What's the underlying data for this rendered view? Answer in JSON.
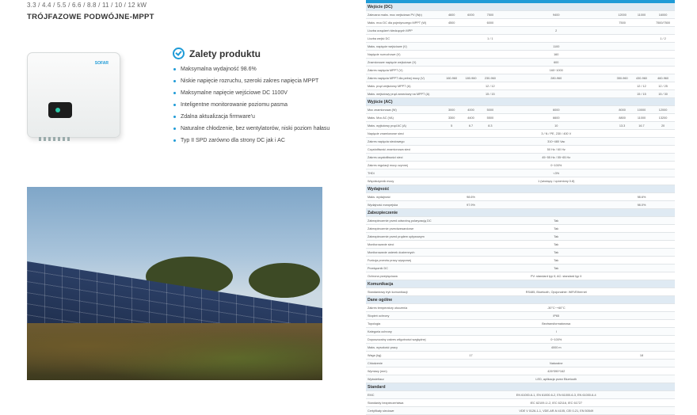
{
  "left": {
    "models": "3.3 / 4.4 / 5.5 / 6.6 / 8.8 / 11 / 10 / 12 kW",
    "heading": "TRÓJFAZOWE PODWÓJNE-MPPT",
    "brand": "SOFAR",
    "features_title": "Zalety produktu",
    "features": [
      "Maksymalna wydajność 98.6%",
      "Niskie napięcie rozruchu, szeroki zakres napięcia MPPT",
      "Maksymalne napięcie wejściowe DC 1100V",
      "Inteligentne monitorowanie poziomu pasma",
      "Zdalna aktualizacja firmware'u",
      "Naturalne chłodzenie, bez wentylatorów, niski poziom hałasu",
      "Typ II SPD zarówno dla strony DC jak i AC"
    ]
  },
  "spec": {
    "rows": [
      {
        "type": "sec",
        "label": "Wejście (DC)"
      },
      {
        "label": "Zalecana maks. moc wejściowa PV (Wp)",
        "values": [
          "4600",
          "6000",
          "7500",
          "9400",
          "12000",
          "11000",
          "16000"
        ]
      },
      {
        "label": "Maks. moc DC dla pojedynczego MPPT (W)",
        "values": [
          "4500",
          "",
          "6000",
          "",
          "7500",
          "",
          "7500/7500"
        ]
      },
      {
        "label": "Liczba urządzeń śledzących MPP",
        "values": [
          "",
          "",
          "",
          "2",
          "",
          "",
          ""
        ]
      },
      {
        "label": "Liczba wejść DC",
        "values": [
          "",
          "",
          "1 / 1",
          "",
          "",
          "",
          "1 / 2"
        ]
      },
      {
        "label": "Maks. napięcie wejściowe (V)",
        "values": [
          "",
          "",
          "",
          "1100",
          "",
          "",
          ""
        ]
      },
      {
        "label": "Napięcie rozruchowe (V)",
        "values": [
          "",
          "",
          "",
          "160",
          "",
          "",
          ""
        ]
      },
      {
        "label": "Znamionowe napięcie wejściowe (V)",
        "values": [
          "",
          "",
          "",
          "600",
          "",
          "",
          ""
        ]
      },
      {
        "label": "Zakres napięcia MPPT (V)",
        "values": [
          "",
          "",
          "",
          "160~1000",
          "",
          "",
          ""
        ]
      },
      {
        "label": "Zakres napięcia MPPT dla pełnej mocy (V)",
        "values": [
          "160-960",
          "180-960",
          "230-960",
          "280-960",
          "350-960",
          "430-960",
          "460-960"
        ]
      },
      {
        "label": "Maks. prąd wejściowy MPPT (A)",
        "values": [
          "",
          "",
          "12 / 12",
          "",
          "",
          "12 / 12",
          "12 / 25"
        ]
      },
      {
        "label": "Maks. wejściowy prąd zwarciowy na MPPT (A)",
        "values": [
          "",
          "",
          "15 / 15",
          "",
          "",
          "15 / 15",
          "15 / 30"
        ]
      },
      {
        "type": "sec",
        "label": "Wyjście (AC)"
      },
      {
        "label": "Moc znamionowa (W)",
        "values": [
          "3000",
          "4000",
          "5000",
          "6000",
          "8000",
          "10000",
          "12000"
        ]
      },
      {
        "label": "Maks. Moc AC (VA)",
        "values": [
          "3300",
          "4400",
          "5500",
          "6600",
          "8800",
          "11000",
          "13200"
        ]
      },
      {
        "label": "Maks. wyjściowy prąd AC (A)",
        "values": [
          "5",
          "6.7",
          "8.3",
          "10",
          "13.3",
          "16.7",
          "20"
        ]
      },
      {
        "label": "Napięcie znamionowe sieci",
        "values": [
          "",
          "",
          "",
          "3 / N / PE, 230 / 400 V",
          "",
          "",
          ""
        ]
      },
      {
        "label": "Zakres napięcia sieciowego",
        "values": [
          "",
          "",
          "",
          "310~480 Vac",
          "",
          "",
          ""
        ]
      },
      {
        "label": "Częstotliwość znamionowa sieci",
        "values": [
          "",
          "",
          "",
          "50 Hz / 60 Hz",
          "",
          "",
          ""
        ]
      },
      {
        "label": "Zakres częstotliwości sieci",
        "values": [
          "",
          "",
          "",
          "45~55 Hz / 55~65 Hz",
          "",
          "",
          ""
        ]
      },
      {
        "label": "Zakres regulacji mocy czynnej",
        "values": [
          "",
          "",
          "",
          "0~100%",
          "",
          "",
          ""
        ]
      },
      {
        "label": "THDi",
        "values": [
          "",
          "",
          "",
          "<3%",
          "",
          "",
          ""
        ]
      },
      {
        "label": "Współczynnik mocy",
        "values": [
          "",
          "",
          "",
          "1 (wiodący / opóźniony 0.8)",
          "",
          "",
          ""
        ]
      },
      {
        "type": "sec",
        "label": "Wydajność"
      },
      {
        "label": "Maks. wydajność",
        "values": [
          "",
          "98.6%",
          "",
          "",
          "",
          "98.6%",
          ""
        ]
      },
      {
        "label": "Wydajność europejska",
        "values": [
          "",
          "97.9%",
          "",
          "",
          "",
          "98.0%",
          ""
        ]
      },
      {
        "type": "sec",
        "label": "Zabezpieczenie"
      },
      {
        "label": "Zabezpieczenie przed odwrotną polaryzacją DC",
        "values": [
          "",
          "",
          "",
          "Tak",
          "",
          "",
          ""
        ]
      },
      {
        "label": "Zabezpieczenie przeciwzwarciowe",
        "values": [
          "",
          "",
          "",
          "Tak",
          "",
          "",
          ""
        ]
      },
      {
        "label": "Zabezpieczenie przed prądem upływowym",
        "values": [
          "",
          "",
          "",
          "Tak",
          "",
          "",
          ""
        ]
      },
      {
        "label": "Monitorowanie sieci",
        "values": [
          "",
          "",
          "",
          "Tak",
          "",
          "",
          ""
        ]
      },
      {
        "label": "Monitorowanie usterek doziemnych",
        "values": [
          "",
          "",
          "",
          "Tak",
          "",
          "",
          ""
        ]
      },
      {
        "label": "Funkcja przeciw pracy wyspowej",
        "values": [
          "",
          "",
          "",
          "Tak",
          "",
          "",
          ""
        ]
      },
      {
        "label": "Przełącznik DC",
        "values": [
          "",
          "",
          "",
          "Tak",
          "",
          "",
          ""
        ]
      },
      {
        "label": "Ochrona przepięciowa",
        "values": [
          "",
          "",
          "",
          "PV: standard typ II; AC: standard typ II",
          "",
          "",
          ""
        ]
      },
      {
        "type": "sec",
        "label": "Komunikacja"
      },
      {
        "label": "Standardowy tryb komunikacji",
        "values": [
          "",
          "",
          "",
          "RS485, Bluetooth, Opcjonalnie: WiFi/Ethernet",
          "",
          "",
          ""
        ]
      },
      {
        "type": "sec",
        "label": "Dane ogólne"
      },
      {
        "label": "Zakres temperatury otoczenia",
        "values": [
          "",
          "",
          "",
          "-30°C~+60°C",
          "",
          "",
          ""
        ]
      },
      {
        "label": "Stopień ochrony",
        "values": [
          "",
          "",
          "",
          "IP65",
          "",
          "",
          ""
        ]
      },
      {
        "label": "Topologia",
        "values": [
          "",
          "",
          "",
          "Beztransformatorowa",
          "",
          "",
          ""
        ]
      },
      {
        "label": "Kategoria ochrony",
        "values": [
          "",
          "",
          "",
          "I",
          "",
          "",
          ""
        ]
      },
      {
        "label": "Dopuszczalny zakres wilgotności względnej",
        "values": [
          "",
          "",
          "",
          "0~100%",
          "",
          "",
          ""
        ]
      },
      {
        "label": "Maks. wysokość pracy",
        "values": [
          "",
          "",
          "",
          "4000 m",
          "",
          "",
          ""
        ]
      },
      {
        "label": "Waga (kg)",
        "values": [
          "",
          "17",
          "",
          "",
          "",
          "18",
          ""
        ]
      },
      {
        "label": "Chłodzenie",
        "values": [
          "",
          "",
          "",
          "Naturalne",
          "",
          "",
          ""
        ]
      },
      {
        "label": "Wymiary (mm)",
        "values": [
          "",
          "",
          "",
          "426*390*162",
          "",
          "",
          ""
        ]
      },
      {
        "label": "Wyświetlacz",
        "values": [
          "",
          "",
          "",
          "LED, aplikacja przez Bluetooth",
          "",
          "",
          ""
        ]
      },
      {
        "type": "sec",
        "label": "Standard"
      },
      {
        "label": "EMC",
        "values": [
          "",
          "",
          "",
          "EN 61000-6-1, EN 61000-6-2, EN 61000-6-3, EN 61000-6-4",
          "",
          "",
          ""
        ]
      },
      {
        "label": "Standardy bezpieczeństwa",
        "values": [
          "",
          "",
          "",
          "IEC 62109-1/-2, IEC 62116, IEC 61727",
          "",
          "",
          ""
        ]
      },
      {
        "label": "Certyfikaty sieciowe",
        "values": [
          "",
          "",
          "",
          "VDE V 0126-1-1, VDE-AR-N 4105, CEI 0-21, EN 50549",
          "",
          "",
          ""
        ]
      }
    ]
  }
}
